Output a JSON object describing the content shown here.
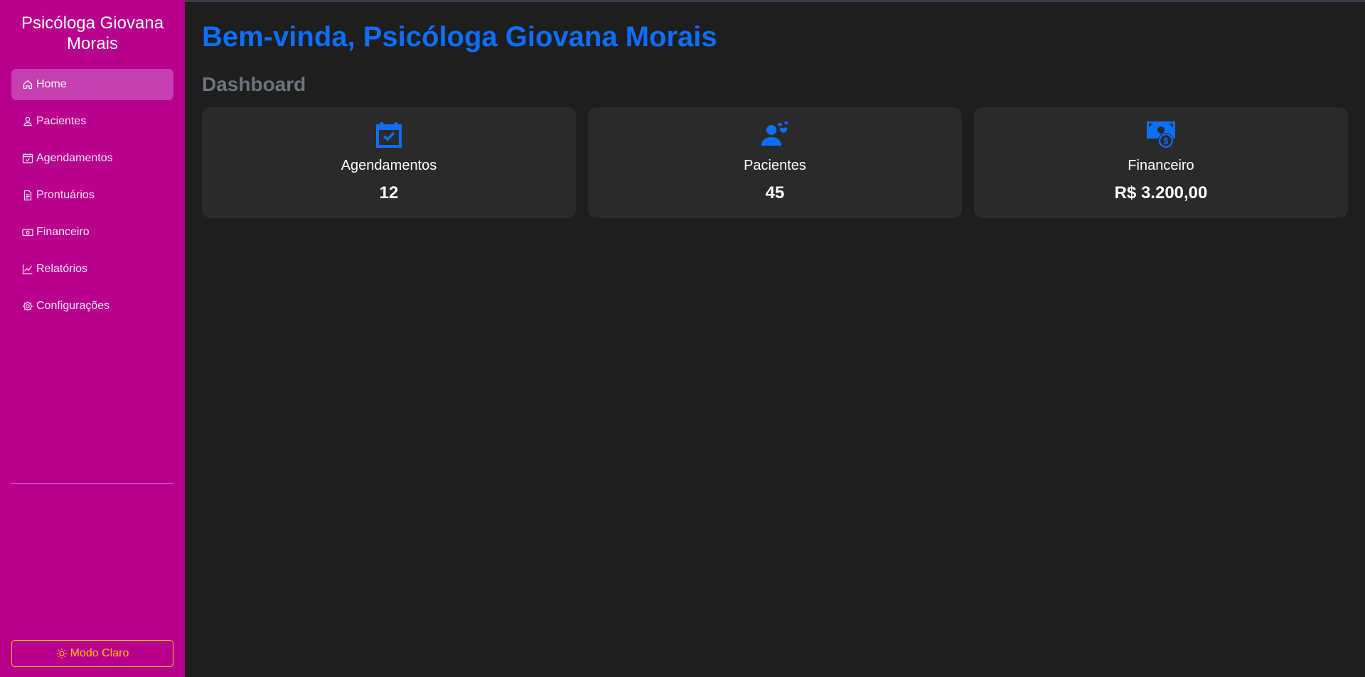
{
  "sidebar": {
    "brand": "Psicóloga Giovana Morais",
    "items": [
      {
        "label": "Home",
        "icon": "house-icon"
      },
      {
        "label": "Pacientes",
        "icon": "person-icon"
      },
      {
        "label": "Agendamentos",
        "icon": "calendar-check-icon"
      },
      {
        "label": "Prontuários",
        "icon": "file-text-icon"
      },
      {
        "label": "Financeiro",
        "icon": "cash-icon"
      },
      {
        "label": "Relatórios",
        "icon": "graph-up-icon"
      },
      {
        "label": "Configurações",
        "icon": "gear-icon"
      }
    ],
    "theme_toggle": {
      "label": "Modo Claro",
      "icon": "sun-icon"
    }
  },
  "main": {
    "welcome": "Bem-vinda, Psicóloga Giovana Morais",
    "section_title": "Dashboard",
    "cards": [
      {
        "label": "Agendamentos",
        "value": "12",
        "icon": "calendar-check-icon"
      },
      {
        "label": "Pacientes",
        "value": "45",
        "icon": "users-heart-icon"
      },
      {
        "label": "Financeiro",
        "value": "R$ 3.200,00",
        "icon": "money-dollar-icon"
      }
    ]
  },
  "colors": {
    "sidebar_bg": "#b8008f",
    "active_item": "#c63fae",
    "accent": "#0d6efd",
    "warning": "#ffc107",
    "main_bg": "#1e1e1e",
    "card_bg": "#2a2a2a"
  }
}
